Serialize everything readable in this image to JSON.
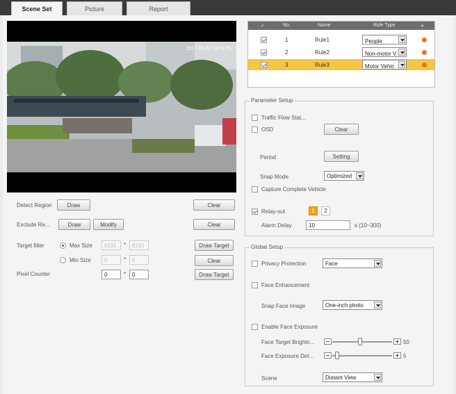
{
  "tabs": [
    {
      "label": "Scene Set"
    },
    {
      "label": "Picture"
    },
    {
      "label": "Report"
    }
  ],
  "video": {
    "osd": "2017-05-31 14:31:25"
  },
  "left": {
    "detect_region": {
      "label": "Detect Region",
      "draw": "Draw",
      "clear": "Clear"
    },
    "exclude_region": {
      "label": "Exclude Re...",
      "draw": "Draw",
      "modify": "Modify",
      "clear": "Clear"
    },
    "target_filter": {
      "label": "Target filter",
      "max_label": "Max Size",
      "max_w": "8191",
      "max_h": "8191",
      "min_label": "Min Size",
      "min_w": "0",
      "min_h": "0",
      "draw_target": "Draw Target",
      "clear": "Clear"
    },
    "pixel_counter": {
      "label": "Pixel Counter",
      "w": "0",
      "h": "0",
      "draw_target": "Draw Target"
    },
    "times_sep": "*"
  },
  "rules": {
    "headers": {
      "check": "✓",
      "no": "No.",
      "name": "Name",
      "type": "Rule Type",
      "add": "+"
    },
    "rows": [
      {
        "no": "1",
        "name": "Rule1",
        "type": "People"
      },
      {
        "no": "2",
        "name": "Rule2",
        "type": "Non-motor V"
      },
      {
        "no": "3",
        "name": "Rule3",
        "type": "Motor Vehic"
      }
    ]
  },
  "param": {
    "title": "Parameter Setup",
    "traffic_flow": "Traffic Flow Stat...",
    "osd": "OSD",
    "osd_btn": "Clear",
    "period": "Period",
    "period_btn": "Setting",
    "snap_mode": "Snap Mode",
    "snap_mode_val": "Optimized",
    "capture": "Capture Complete Vehicle",
    "relay": "Relay-out",
    "relay_1": "1",
    "relay_2": "2",
    "alarm_delay": "Alarm Delay",
    "alarm_delay_val": "10",
    "alarm_delay_unit": "s (10~300)"
  },
  "global": {
    "title": "Global Setup",
    "privacy": "Privacy Protection",
    "privacy_val": "Face",
    "face_enh": "Face Enhancement",
    "snap_face": "Snap Face Image",
    "snap_face_val": "One-inch photo",
    "face_exp": "Enable Face Exposure",
    "face_bright": "Face Target Brightn...",
    "face_bright_val": "50",
    "face_exp_det": "Face Exposure Det...",
    "face_exp_det_val": "5",
    "scene": "Scene",
    "scene_val": "Distant View"
  }
}
